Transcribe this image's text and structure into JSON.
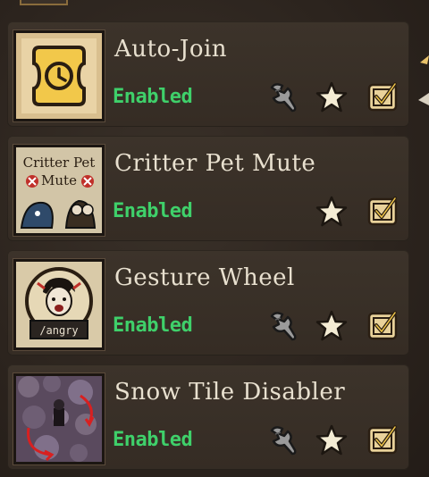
{
  "mods": [
    {
      "name": "Auto-Join",
      "status": "Enabled",
      "has_config": true,
      "thumb_icon": "clock-ticket-icon"
    },
    {
      "name": "Critter Pet Mute",
      "status": "Enabled",
      "has_config": false,
      "thumb_icon": "critter-pet-mute-thumbnail",
      "thumb_text": {
        "line1": "Critter Pet",
        "line2": "Mute"
      }
    },
    {
      "name": "Gesture Wheel",
      "status": "Enabled",
      "has_config": true,
      "thumb_icon": "gesture-wheel-thumbnail",
      "thumb_text": {
        "caption": "/angry"
      }
    },
    {
      "name": "Snow Tile Disabler",
      "status": "Enabled",
      "has_config": true,
      "thumb_icon": "snow-tile-thumbnail"
    }
  ],
  "colors": {
    "status_enabled": "#3fd06a",
    "name_text": "#e8e0cf",
    "row_bg": "#3c332a",
    "accent_gold": "#e8c26a"
  }
}
